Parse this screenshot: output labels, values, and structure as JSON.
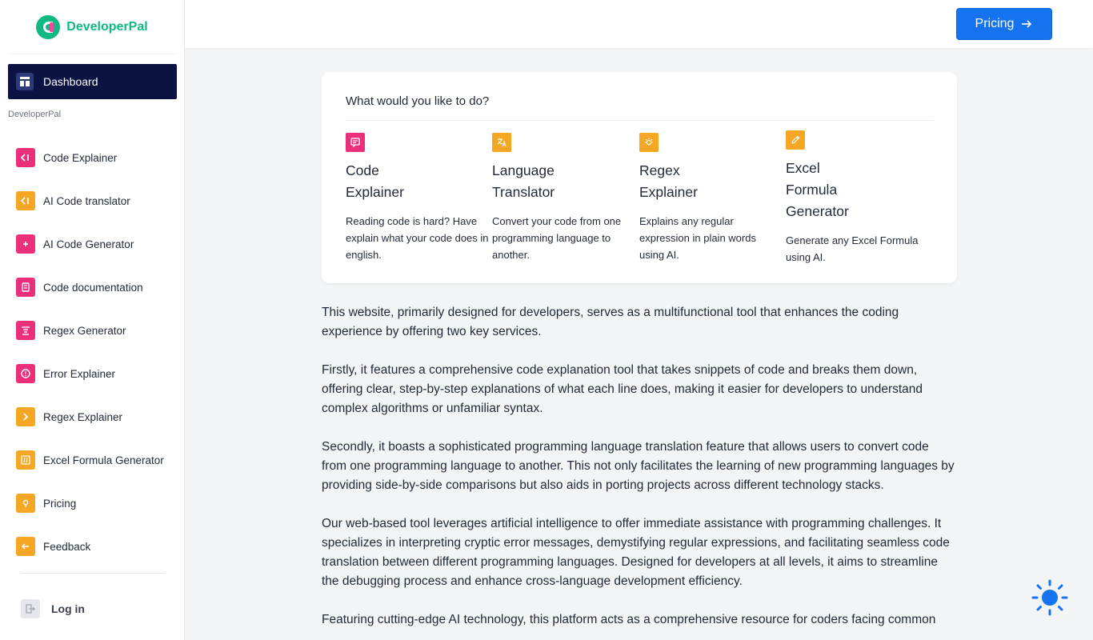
{
  "brand": {
    "name": "DeveloperPal",
    "logo_icon": "developerpal-logo"
  },
  "sidebar": {
    "dashboard_label": "Dashboard",
    "section_label": "DeveloperPal",
    "items": [
      {
        "label": "Code Explainer",
        "icon": "code-bracket-icon",
        "color": "#ec2f7a"
      },
      {
        "label": "AI Code translator",
        "icon": "code-bracket-icon",
        "color": "#f5a623"
      },
      {
        "label": "AI Code Generator",
        "icon": "plus-icon",
        "color": "#ec2f7a"
      },
      {
        "label": "Code documentation",
        "icon": "document-icon",
        "color": "#ec2f7a"
      },
      {
        "label": "Regex Generator",
        "icon": "filter-lines-icon",
        "color": "#ec2f7a"
      },
      {
        "label": "Error Explainer",
        "icon": "alert-circle-icon",
        "color": "#ec2f7a"
      },
      {
        "label": "Regex Explainer",
        "icon": "chevron-right-icon",
        "color": "#f5a623"
      },
      {
        "label": "Excel Formula Generator",
        "icon": "formula-icon",
        "color": "#f5a623"
      },
      {
        "label": "Pricing",
        "icon": "location-pin-icon",
        "color": "#f5a623"
      },
      {
        "label": "Feedback",
        "icon": "arrow-left-icon",
        "color": "#f5a623"
      }
    ],
    "login_label": "Log in"
  },
  "topbar": {
    "pricing_label": "Pricing"
  },
  "card": {
    "title": "What would you like to do?",
    "options": [
      {
        "title_lines": [
          "Code",
          "Explainer"
        ],
        "desc": "Reading code is hard? Have explain what your code does in english.",
        "icon": "chat-bubble-icon",
        "color": "#ec2f7a"
      },
      {
        "title_lines": [
          "Language",
          "Translator"
        ],
        "desc": "Convert your code from one programming language to another.",
        "icon": "translate-icon",
        "color": "#f5a623"
      },
      {
        "title_lines": [
          "Regex",
          "Explainer"
        ],
        "desc": "Explains any regular expression in plain words using AI.",
        "icon": "lightbulb-icon",
        "color": "#f5a623"
      },
      {
        "title_lines": [
          "Excel",
          "Formula",
          "Generator"
        ],
        "desc": "Generate any Excel Formula using AI.",
        "icon": "pencil-icon",
        "color": "#f5a623"
      }
    ]
  },
  "content": {
    "paragraphs": [
      "This website, primarily designed for developers, serves as a multifunctional tool that enhances the coding experience by offering two key services.",
      "Firstly, it features a comprehensive code explanation tool that takes snippets of code and breaks them down, offering clear, step-by-step explanations of what each line does, making it easier for developers to understand complex algorithms or unfamiliar syntax.",
      "Secondly, it boasts a sophisticated programming language translation feature that allows users to convert code from one programming language to another. This not only facilitates the learning of new programming languages by providing side-by-side comparisons but also aids in porting projects across different technology stacks.",
      "Our web-based tool leverages artificial intelligence to offer immediate assistance with programming challenges. It specializes in interpreting cryptic error messages, demystifying regular expressions, and facilitating seamless code translation between different programming languages. Designed for developers at all levels, it aims to streamline the debugging process and enhance cross-language development efficiency.",
      "Featuring cutting-edge AI technology, this platform acts as a comprehensive resource for coders facing common"
    ]
  },
  "theme_toggle": {
    "icon": "sun-icon",
    "color": "#1673f0"
  }
}
